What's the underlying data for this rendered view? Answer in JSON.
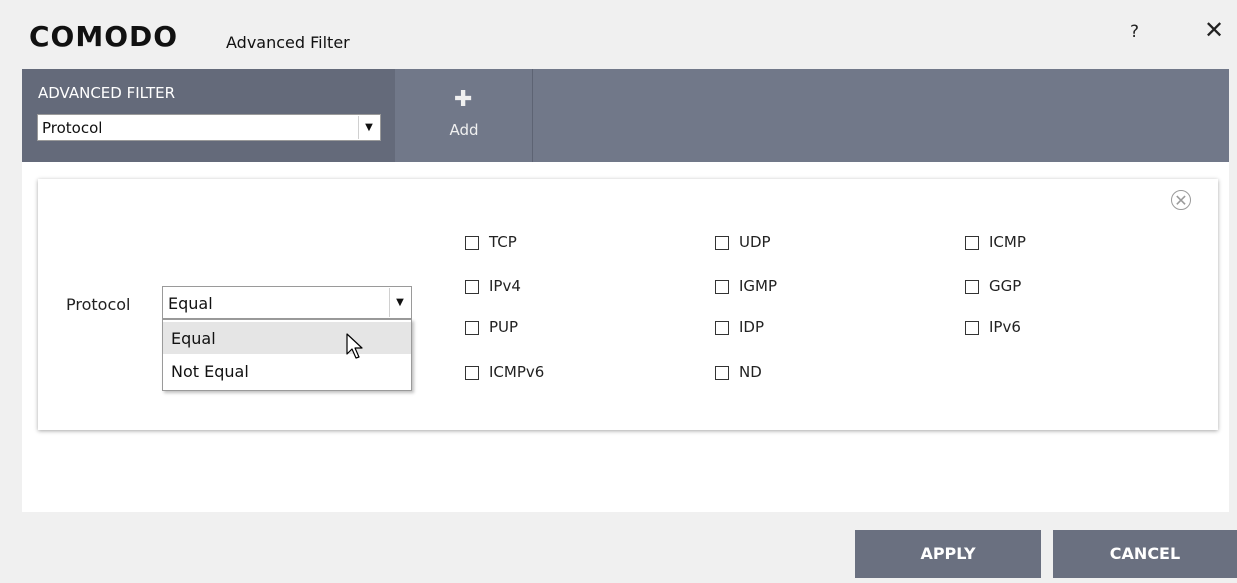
{
  "window": {
    "brand": "COMODO",
    "title": "Advanced Filter",
    "help_label": "?",
    "close_label": "✕"
  },
  "toolbar": {
    "heading": "ADVANCED FILTER",
    "filter_select_value": "Protocol",
    "add_label": "Add",
    "add_icon": "plus-icon"
  },
  "filter": {
    "label": "Protocol",
    "condition_value": "Equal",
    "condition_options": [
      "Equal",
      "Not Equal"
    ],
    "highlighted_option": "Equal",
    "protocols": [
      "TCP",
      "UDP",
      "ICMP",
      "IPv4",
      "IGMP",
      "GGP",
      "PUP",
      "IDP",
      "IPv6",
      "ICMPv6",
      "ND"
    ]
  },
  "footer": {
    "apply_label": "APPLY",
    "cancel_label": "CANCEL"
  },
  "colors": {
    "toolbar_bg": "#717889",
    "toolbar_section_bg": "#646a7a",
    "button_bg": "#6a7080"
  }
}
